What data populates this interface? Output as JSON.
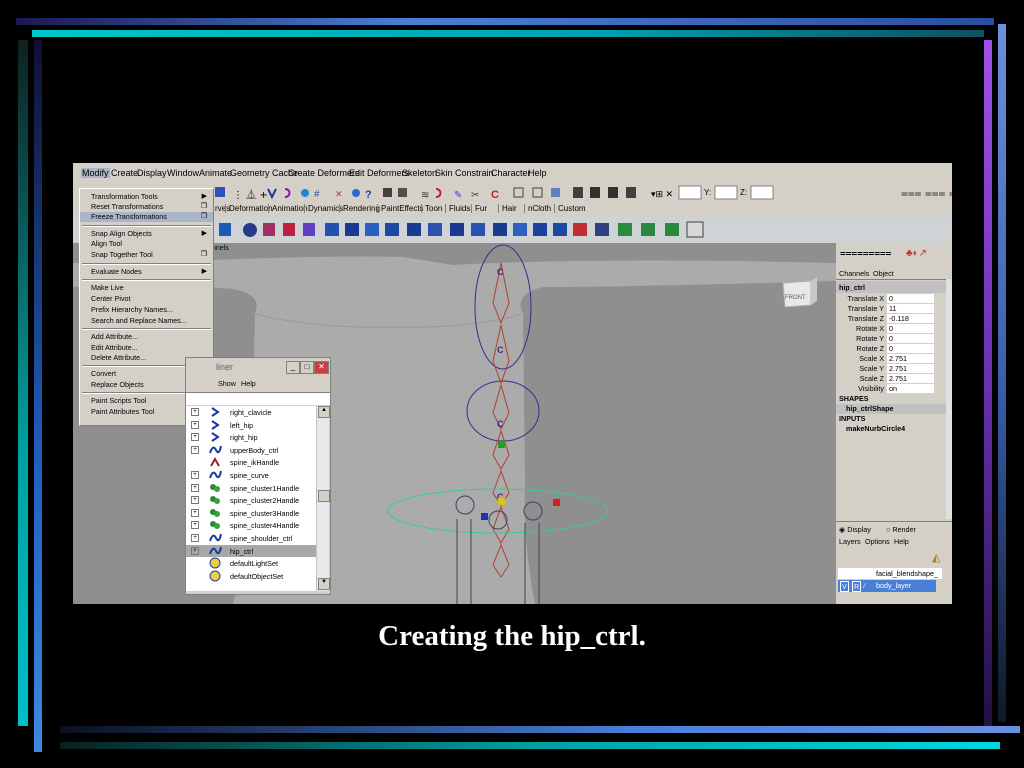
{
  "caption": "Creating the hip_ctrl.",
  "menubar": [
    "Modify",
    "Create",
    "Display",
    "Window",
    "Animate",
    "Geometry Cache",
    "Create Deformers",
    "Edit Deformers",
    "Skeleton",
    "Skin",
    "Constrain",
    "Character",
    "Help"
  ],
  "shelf_tabs": [
    "rves",
    "Deformation",
    "Animation",
    "Dynamics",
    "Rendering",
    "PaintEffects",
    "Toon",
    "Fluids",
    "Fur",
    "Hair",
    "nCloth",
    "Custom"
  ],
  "viewport": {
    "panel_label": "nnels",
    "view_cube_label": "FRONT"
  },
  "modify_menu": [
    {
      "label": "Transformation Tools",
      "submenu": true
    },
    {
      "label": "Reset Transformations",
      "option": true
    },
    {
      "label": "Freeze Transformations",
      "option": true,
      "highlighted": true
    },
    {
      "label": "Snap Align Objects",
      "submenu": true
    },
    {
      "label": "Align Tool"
    },
    {
      "label": "Snap Together Tool",
      "option": true
    },
    {
      "label": "Evaluate Nodes",
      "submenu": true
    },
    {
      "label": "Make Live"
    },
    {
      "label": "Center Pivot"
    },
    {
      "label": "Prefix Hierarchy Names..."
    },
    {
      "label": "Search and Replace Names..."
    },
    {
      "label": "Add Attribute..."
    },
    {
      "label": "Edit Attribute..."
    },
    {
      "label": "Delete Attribute..."
    },
    {
      "label": "Convert",
      "submenu": true
    },
    {
      "label": "Replace Objects",
      "option": true
    },
    {
      "label": "Paint Scripts Tool",
      "option": true
    },
    {
      "label": "Paint Attributes Tool",
      "option": true
    }
  ],
  "outliner": {
    "title": "liner",
    "menu": [
      "Show",
      "Help"
    ],
    "items": [
      {
        "label": "right_clavicle",
        "type": "joint",
        "expand": true
      },
      {
        "label": "left_hip",
        "type": "joint",
        "expand": true
      },
      {
        "label": "right_hip",
        "type": "joint",
        "expand": true
      },
      {
        "label": "upperBody_ctrl",
        "type": "curve",
        "expand": true
      },
      {
        "label": "spine_ikHandle",
        "type": "ik",
        "expand": false
      },
      {
        "label": "spine_curve",
        "type": "curve",
        "expand": true
      },
      {
        "label": "spine_cluster1Handle",
        "type": "cluster",
        "expand": true
      },
      {
        "label": "spine_cluster2Handle",
        "type": "cluster",
        "expand": true
      },
      {
        "label": "spine_cluster3Handle",
        "type": "cluster",
        "expand": true
      },
      {
        "label": "spine_cluster4Handle",
        "type": "cluster",
        "expand": true
      },
      {
        "label": "spine_shoulder_ctrl",
        "type": "curve",
        "expand": true
      },
      {
        "label": "hip_ctrl",
        "type": "curve",
        "expand": true,
        "selected": true
      },
      {
        "label": "defaultLightSet",
        "type": "set",
        "expand": false
      },
      {
        "label": "defaultObjectSet",
        "type": "set",
        "expand": false
      }
    ]
  },
  "channel_box": {
    "tabs": [
      "Channels",
      "Object"
    ],
    "object": "hip_ctrl",
    "channels": [
      {
        "name": "Translate X",
        "value": "0"
      },
      {
        "name": "Translate Y",
        "value": "11"
      },
      {
        "name": "Translate Z",
        "value": "-0.118"
      },
      {
        "name": "Rotate X",
        "value": "0"
      },
      {
        "name": "Rotate Y",
        "value": "0"
      },
      {
        "name": "Rotate Z",
        "value": "0"
      },
      {
        "name": "Scale X",
        "value": "2.751"
      },
      {
        "name": "Scale Y",
        "value": "2.751"
      },
      {
        "name": "Scale Z",
        "value": "2.751"
      },
      {
        "name": "Visibility",
        "value": "on"
      }
    ],
    "shapes_header": "SHAPES",
    "shape": "hip_ctrlShape",
    "inputs_header": "INPUTS",
    "input": "makeNurbCircle4"
  },
  "layer_editor": {
    "display_label": "Display",
    "render_label": "Render",
    "menu": [
      "Layers",
      "Options",
      "Help"
    ],
    "layers": [
      {
        "label": "facial_blendshape_"
      },
      {
        "label": "body_layer",
        "v": "V",
        "r": "R",
        "selected": true
      }
    ]
  },
  "fields": {
    "y_label": "Y:",
    "z_label": "Z:"
  },
  "colors": {
    "background": "#000000",
    "accent_cyan": "#00c8c8",
    "accent_blue": "#4a7fd8",
    "accent_purple": "#8b3dd8"
  }
}
